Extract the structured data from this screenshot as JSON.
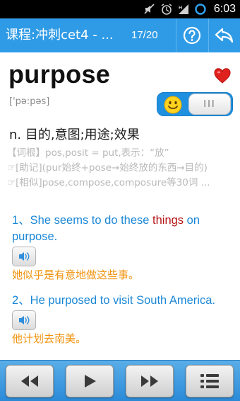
{
  "status_bar": {
    "time": "6:03",
    "icons": [
      "mute-icon",
      "alarm-icon",
      "signal-icon",
      "sync-icon"
    ]
  },
  "action_bar": {
    "title": "课程:冲刺cet4 - ...",
    "progress": "17/20",
    "help_icon": "help-icon",
    "back_icon": "back-icon"
  },
  "word": {
    "text": "purpose",
    "phonetic": "['pə:pəs]",
    "meaning": "n. 目的,意图;用途;效果",
    "notes": [
      "【词根】pos,posit = put,表示：“放”",
      "☞[助记](pur始终+pose→始终放的东西→目的)",
      "☞[相似]pose,compose,composure等30词 ..."
    ]
  },
  "examples": [
    {
      "en_before": "1、She seems to do these ",
      "en_highlight": "things",
      "en_after": " on purpose.",
      "cn": "她似乎是有意地做这些事。"
    },
    {
      "en_before": "2、He purposed to visit South America.",
      "en_highlight": "",
      "en_after": "",
      "cn": "他计划去南美。"
    }
  ],
  "colors": {
    "action_bar": "#2f9be6",
    "example_en": "#1a87d6",
    "example_highlight": "#b41414",
    "example_cn": "#f0930e",
    "heart": "#e0221f"
  },
  "bottom_bar": {
    "buttons": [
      "rewind-icon",
      "play-icon",
      "fast-forward-icon",
      "list-icon"
    ]
  }
}
